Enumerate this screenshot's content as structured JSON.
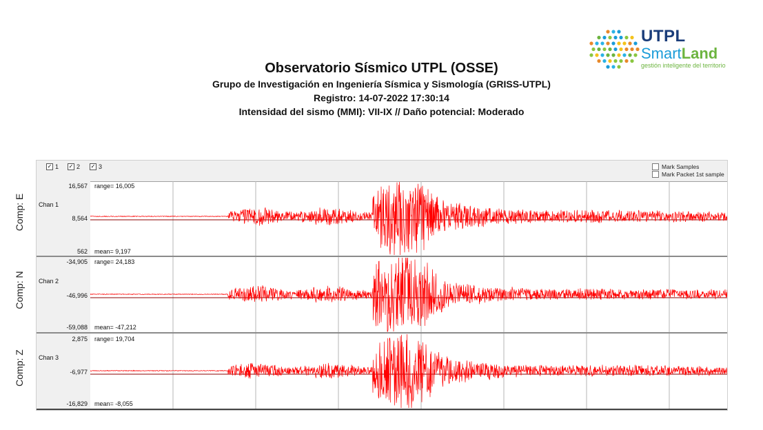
{
  "header": {
    "title": "Observatorio Sísmico UTPL (OSSE)",
    "line1": "Grupo de Investigación en Ingeniería Sísmica y Sismología (GRISS-UTPL)",
    "line2": "Registro: 14-07-2022 17:30:14",
    "line3": "Intensidad del sismo (MMI): VII-IX // Daño potencial: Moderado"
  },
  "logo": {
    "utpl": "UTPL",
    "smart": "Smart",
    "land": "Land",
    "tagline": "gestión inteligente del territorio"
  },
  "toolbar": {
    "channels": [
      {
        "label": "1",
        "checked": true
      },
      {
        "label": "2",
        "checked": true
      },
      {
        "label": "3",
        "checked": true
      }
    ],
    "mark_samples": "Mark Samples",
    "mark_packet": "Mark Packet 1st sample"
  },
  "colors": {
    "trace": "#ff0000",
    "grid": "#b4b4b4",
    "panel_bg": "#f0f0f0"
  },
  "chart_data": {
    "type": "line",
    "series": [
      {
        "component": "Comp: E",
        "channel": "Chan 1",
        "y_top": "16,567",
        "y_mid": "8,564",
        "y_bottom": "562",
        "range": "range= 16,005",
        "mean": "mean= 9,197",
        "ylim": [
          562,
          16567
        ],
        "mean_value": 9197
      },
      {
        "component": "Comp: N",
        "channel": "Chan 2",
        "y_top": "-34,905",
        "y_mid": "-46,996",
        "y_bottom": "-59,088",
        "range": "range= 24,183",
        "mean": "mean= -47,212",
        "ylim": [
          -59088,
          -34905
        ],
        "mean_value": -47212
      },
      {
        "component": "Comp: Z",
        "channel": "Chan 3",
        "y_top": "2,875",
        "y_mid": "-6,977",
        "y_bottom": "-16,829",
        "range": "range= 19,704",
        "mean": "mean= -8,055",
        "ylim": [
          -16829,
          2875
        ],
        "mean_value": -8055
      }
    ]
  }
}
